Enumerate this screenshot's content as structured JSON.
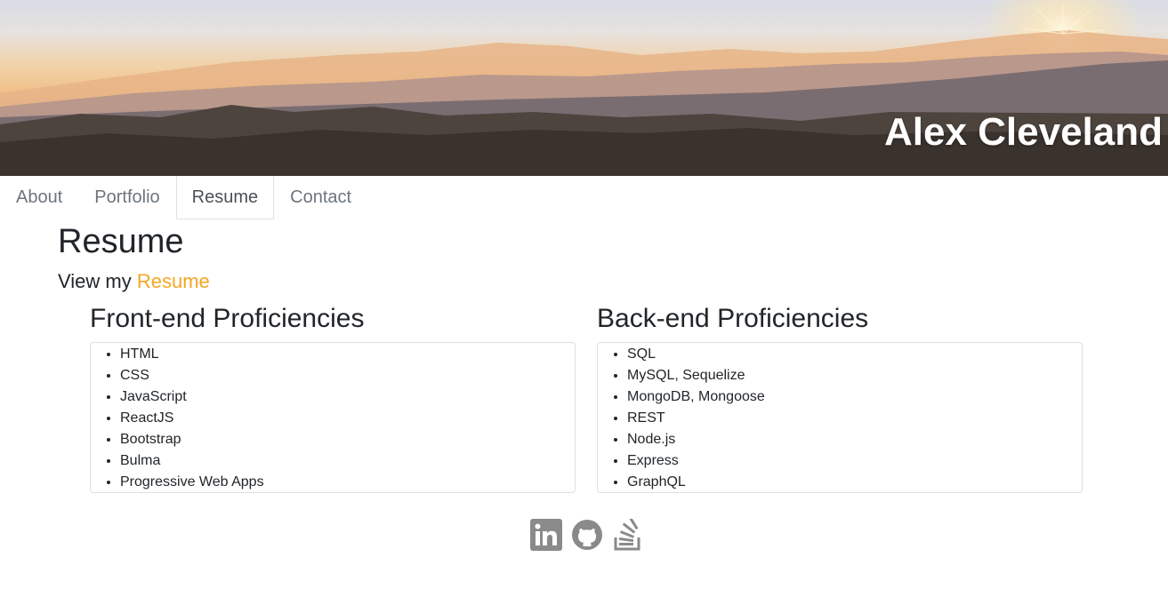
{
  "header": {
    "name": "Alex Cleveland"
  },
  "nav": {
    "items": [
      {
        "label": "About"
      },
      {
        "label": "Portfolio"
      },
      {
        "label": "Resume"
      },
      {
        "label": "Contact"
      }
    ],
    "active": "Resume"
  },
  "main": {
    "title": "Resume",
    "view_prefix": "View my ",
    "view_link": "Resume"
  },
  "frontend": {
    "heading": "Front-end Proficiencies",
    "items": [
      "HTML",
      "CSS",
      "JavaScript",
      "ReactJS",
      "Bootstrap",
      "Bulma",
      "Progressive Web Apps"
    ]
  },
  "backend": {
    "heading": "Back-end Proficiencies",
    "items": [
      "SQL",
      "MySQL, Sequelize",
      "MongoDB, Mongoose",
      "REST",
      "Node.js",
      "Express",
      "GraphQL"
    ]
  },
  "social": {
    "icons": [
      "linkedin-icon",
      "github-icon",
      "stackoverflow-icon"
    ],
    "color": "#8a8a8a"
  },
  "colors": {
    "accent": "#f5a623",
    "text": "#212529",
    "muted": "#6c757d"
  }
}
